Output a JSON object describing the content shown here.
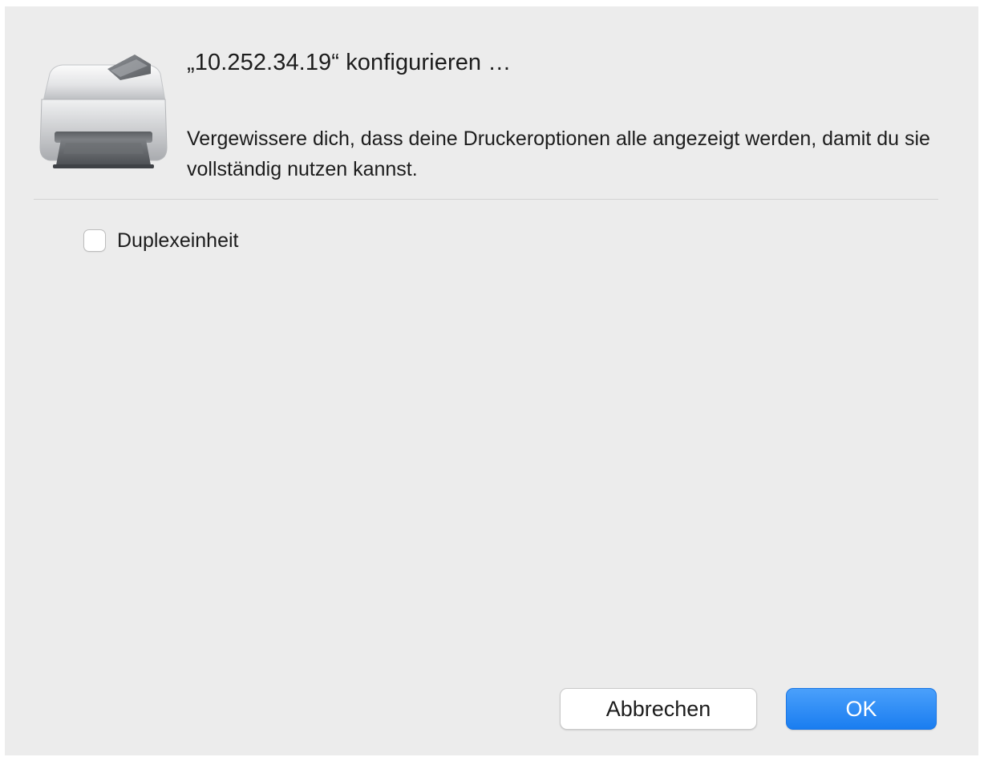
{
  "dialog": {
    "title": "„10.252.34.19“ konfigurieren …",
    "message": "Vergewissere dich, dass deine Druckeroptionen alle angezeigt werden, damit du sie vollständig nutzen kannst.",
    "icon": "printer-icon"
  },
  "options": [
    {
      "label": "Duplexeinheit",
      "checked": false
    }
  ],
  "buttons": {
    "cancel_label": "Abbrechen",
    "ok_label": "OK"
  },
  "colors": {
    "dialog_background": "#ececec",
    "accent_button": "#1a7df0"
  }
}
